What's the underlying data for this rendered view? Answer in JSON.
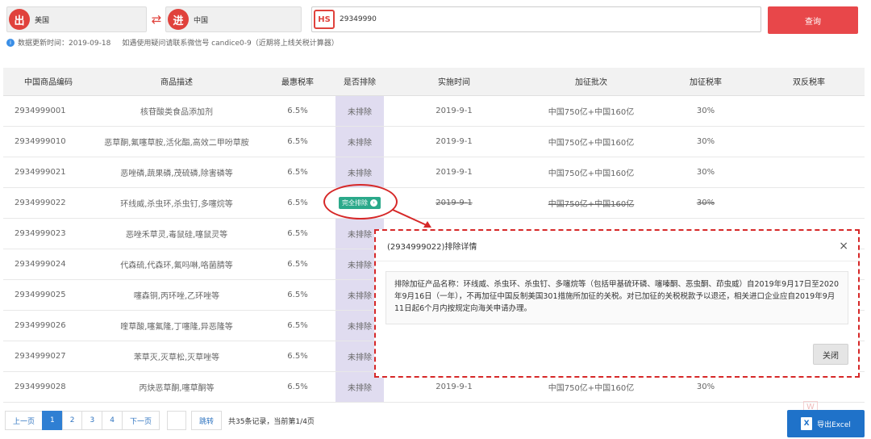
{
  "search": {
    "from_badge": "出",
    "from_value": "美国",
    "to_badge": "进",
    "to_value": "中国",
    "swap_icon": "⇄",
    "hs_badge": "HS",
    "hs_value": "29349990",
    "query_label": "查询"
  },
  "info": {
    "icon": "i",
    "update_text": "数据更新时间：2019-09-18",
    "contact_text": "如遇使用疑问请联系微信号 candice0-9（近期将上线关税计算器）"
  },
  "table": {
    "headers": [
      "中国商品编码",
      "商品描述",
      "最惠税率",
      "是否排除",
      "实施时间",
      "加征批次",
      "加征税率",
      "双反税率"
    ],
    "rows": [
      {
        "code": "2934999001",
        "desc": "核苷酸类食品添加剂",
        "rate": "6.5%",
        "excl": "未排除",
        "date": "2019-9-1",
        "batch": "中国750亿+中国160亿",
        "add_rate": "30%",
        "dual": ""
      },
      {
        "code": "2934999010",
        "desc": "恶草酮,氟噻草胺,活化酯,高效二甲吩草胺",
        "rate": "6.5%",
        "excl": "未排除",
        "date": "2019-9-1",
        "batch": "中国750亿+中国160亿",
        "add_rate": "30%",
        "dual": ""
      },
      {
        "code": "2934999021",
        "desc": "恶唑磷,蔬果磷,茂硫磷,除害磷等",
        "rate": "6.5%",
        "excl": "未排除",
        "date": "2019-9-1",
        "batch": "中国750亿+中国160亿",
        "add_rate": "30%",
        "dual": ""
      },
      {
        "code": "2934999022",
        "desc": "环线威,杀虫环,杀虫钉,多噻烷等",
        "rate": "6.5%",
        "excl": "完全排除",
        "date": "2019-9-1",
        "batch": "中国750亿+中国160亿",
        "add_rate": "30%",
        "dual": ""
      },
      {
        "code": "2934999023",
        "desc": "恶唑禾草灵,毒鼠硅,噻鼠灵等",
        "rate": "6.5%",
        "excl": "未排除",
        "date": "",
        "batch": "",
        "add_rate": "",
        "dual": ""
      },
      {
        "code": "2934999024",
        "desc": "代森硫,代森环,氟吗啉,咯菌腈等",
        "rate": "6.5%",
        "excl": "未排除",
        "date": "",
        "batch": "",
        "add_rate": "",
        "dual": ""
      },
      {
        "code": "2934999025",
        "desc": "噻森铜,丙环唑,乙环唑等",
        "rate": "6.5%",
        "excl": "未排除",
        "date": "",
        "batch": "",
        "add_rate": "",
        "dual": ""
      },
      {
        "code": "2934999026",
        "desc": "喹草酸,噻氟隆,丁噻隆,异恶隆等",
        "rate": "6.5%",
        "excl": "未排除",
        "date": "",
        "batch": "",
        "add_rate": "",
        "dual": ""
      },
      {
        "code": "2934999027",
        "desc": "苯草灭,灭草松,灭草唑等",
        "rate": "6.5%",
        "excl": "未排除",
        "date": "",
        "batch": "",
        "add_rate": "",
        "dual": ""
      },
      {
        "code": "2934999028",
        "desc": "丙炔恶草酮,噻草酮等",
        "rate": "6.5%",
        "excl": "未排除",
        "date": "2019-9-1",
        "batch": "中国750亿+中国160亿",
        "add_rate": "30%",
        "dual": ""
      }
    ]
  },
  "modal": {
    "title": "(2934999022)排除详情",
    "close_icon": "×",
    "body": "排除加征产品名称：环线威、杀虫环、杀虫钉、多噻烷等（包括甲基硫环磷、噻嗪酮、恶虫酮、茚虫威）自2019年9月17日至2020年9月16日（一年），不再加征中国反制美国301措施所加征的关税。对已加征的关税税款予以退还，相关进口企业应自2019年9月11日起6个月内按规定向海关申请办理。",
    "close_label": "关闭"
  },
  "pager": {
    "prev": "上一页",
    "pages": [
      "1",
      "2",
      "3",
      "4"
    ],
    "next": "下一页",
    "jump": "跳转",
    "total": "共35条记录，当前第1/4页"
  },
  "export": {
    "icon": "X",
    "label": "导出Excel"
  },
  "colors": {
    "accent_red": "#e8474a",
    "excluded_bg": "#e0dcf0",
    "full_excluded": "#2ba98a",
    "primary_blue": "#2f7fd3"
  }
}
